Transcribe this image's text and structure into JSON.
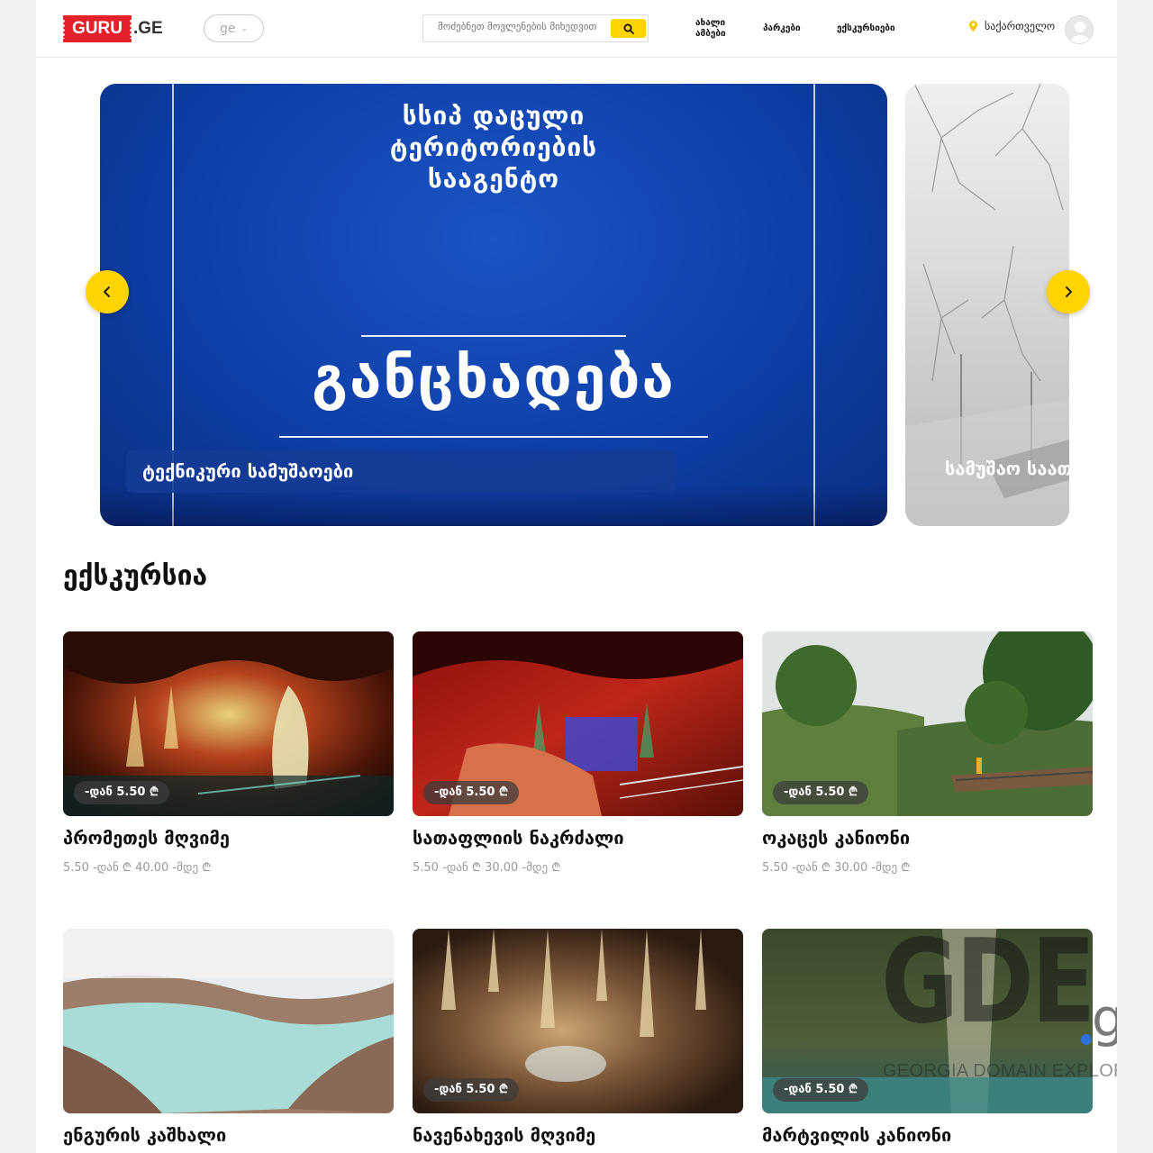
{
  "header": {
    "logo_main": "GURU",
    "logo_suffix": ".GE",
    "language": "ge",
    "search_placeholder": "მოძებნეთ მოვლენების მიხედვით",
    "nav": [
      {
        "label_line1": "ახალი",
        "label_line2": "ამბები"
      },
      {
        "label_line1": "პარკები",
        "label_line2": ""
      },
      {
        "label_line1": "ექსკურსიები",
        "label_line2": ""
      }
    ],
    "location": "საქართველო"
  },
  "slider": {
    "main": {
      "heading": [
        "სსიპ დაცული",
        "ტერიტორიების",
        "სააგენტო"
      ],
      "big_text": "განცხადება",
      "caption": "ტექნიკური სამუშაოები"
    },
    "side": {
      "caption": "სამუშაო საათები"
    }
  },
  "section": {
    "title": "ექსკურსია",
    "cards": [
      {
        "title": "პრომეთეს მღვიმე",
        "price_tag": "-დან 5.50 ₾",
        "range": "5.50 -დან ₾ 40.00 -მდე ₾"
      },
      {
        "title": "სათაფლიის ნაკრძალი",
        "price_tag": "-დან 5.50 ₾",
        "range": "5.50 -დან ₾ 30.00 -მდე ₾"
      },
      {
        "title": "ოკაცეს კანიონი",
        "price_tag": "-დან 5.50 ₾",
        "range": "5.50 -დან ₾ 30.00 -მდე ₾"
      },
      {
        "title": "ენგურის კაშხალი",
        "price_tag": "",
        "range": ""
      },
      {
        "title": "ნავენახევის მღვიმე",
        "price_tag": "-დან 5.50 ₾",
        "range": ""
      },
      {
        "title": "მარტვილის კანიონი",
        "price_tag": "-დან 5.50 ₾",
        "range": ""
      }
    ]
  },
  "watermark": {
    "big": "GDE",
    "suffix": "ge",
    "subtitle": "GEORGIA DOMAIN EXPLORER"
  },
  "colors": {
    "accent": "#ffd400",
    "brand_red": "#e4202b",
    "slide_blue": "#0e3fa8"
  },
  "icons": [
    "search-icon",
    "chevron-down-icon",
    "location-pin-icon",
    "user-icon",
    "chevron-left-icon",
    "chevron-right-icon"
  ]
}
